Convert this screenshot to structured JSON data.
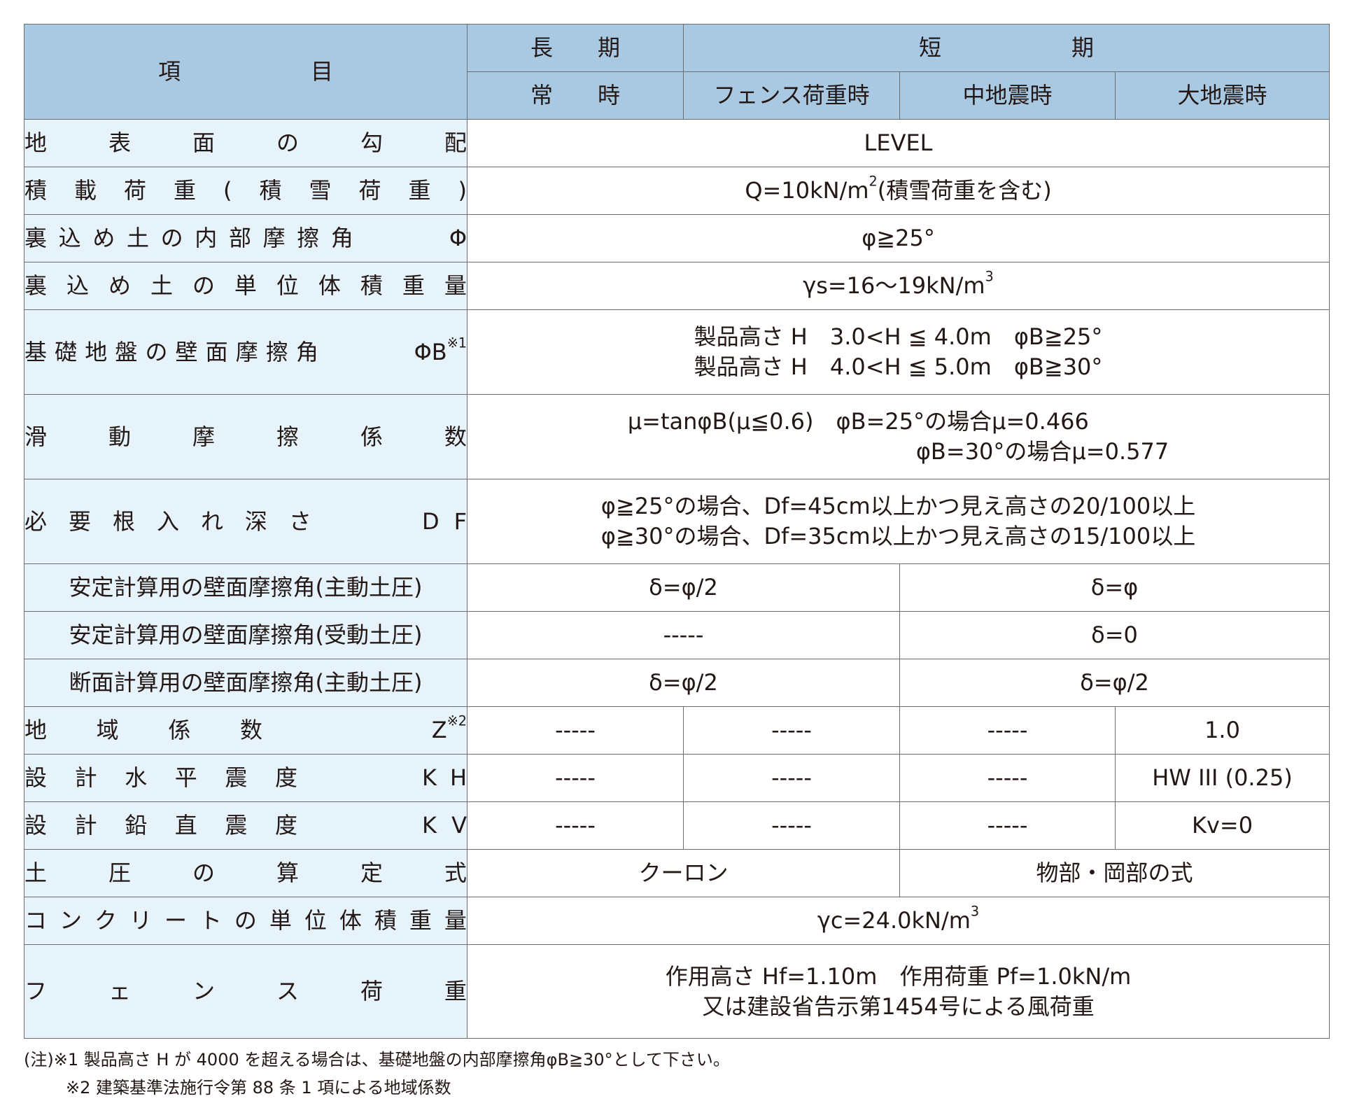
{
  "header": {
    "item": "項目",
    "long_term": "長期",
    "short_term": "短期",
    "normal": "常時",
    "fence_load": "フェンス荷重時",
    "medium_quake": "中地震時",
    "large_quake": "大地震時"
  },
  "rows": {
    "slope": {
      "label": "地表面の勾配",
      "value": "LEVEL"
    },
    "surcharge": {
      "label": "積載荷重(積雪荷重)",
      "value_pre": "Q=10kN/m",
      "value_sup": "2",
      "value_post": "(積雪荷重を含む)"
    },
    "friction": {
      "label": "裏込め土の内部摩擦角",
      "symbol": "Φ",
      "value": "φ≧25°"
    },
    "unit_weight": {
      "label": "裏込め土の単位体積重量",
      "value_pre": "γs=16〜19kN/m",
      "value_sup": "3"
    },
    "base_friction": {
      "label": "基礎地盤の壁面摩擦角",
      "symbol": "ΦB",
      "symbol_sup": "※1",
      "lines": [
        "製品高さ H　3.0<H ≦ 4.0m　φB≧25°",
        "製品高さ H　4.0<H ≦ 5.0m　φB≧30°"
      ]
    },
    "sliding": {
      "label": "滑動摩擦係数",
      "line1": "μ=tanφB(μ≦0.6)　φB=25°の場合μ=0.466",
      "line2": "φB=30°の場合μ=0.577"
    },
    "embedment": {
      "label": "必要根入れ深さ",
      "symbol": "DF",
      "lines": [
        "φ≧25°の場合、Df=45cm以上かつ見え高さの20/100以上",
        "φ≧30°の場合、Df=35cm以上かつ見え高さの15/100以上"
      ]
    },
    "stab_active": {
      "label": "安定計算用の壁面摩擦角(主動土圧)",
      "long": "δ=φ/2",
      "short": "δ=φ"
    },
    "stab_passive": {
      "label": "安定計算用の壁面摩擦角(受動土圧)",
      "long": "-----",
      "short": "δ=0"
    },
    "section_active": {
      "label": "断面計算用の壁面摩擦角(主動土圧)",
      "long": "δ=φ/2",
      "short": "δ=φ/2"
    },
    "zone": {
      "label": "地域係数",
      "symbol": "Z",
      "symbol_sup": "※2",
      "c1": "-----",
      "c2": "-----",
      "c3": "-----",
      "c4": "1.0"
    },
    "kh": {
      "label": "設計水平震度",
      "symbol": "KH",
      "c1": "-----",
      "c2": "-----",
      "c3": "-----",
      "c4": "HW III (0.25)"
    },
    "kv": {
      "label": "設計鉛直震度",
      "symbol": "KV",
      "c1": "-----",
      "c2": "-----",
      "c3": "-----",
      "c4": "Kv=0"
    },
    "earth_formula": {
      "label": "土圧の算定式",
      "long": "クーロン",
      "short": "物部・岡部の式"
    },
    "concrete": {
      "label": "コンクリートの単位体積重量",
      "value_pre": "γc=24.0kN/m",
      "value_sup": "3"
    },
    "fence": {
      "label": "フェンス荷重",
      "lines": [
        "作用高さ Hf=1.10m　作用荷重 Pf=1.0kN/m",
        "又は建設省告示第1454号による風荷重"
      ]
    }
  },
  "notes": [
    "(注)※1 製品高さ H が 4000 を超える場合は、基礎地盤の内部摩擦角φB≧30°として下さい。",
    "※2 建築基準法施行令第 88 条 1 項による地域係数"
  ]
}
